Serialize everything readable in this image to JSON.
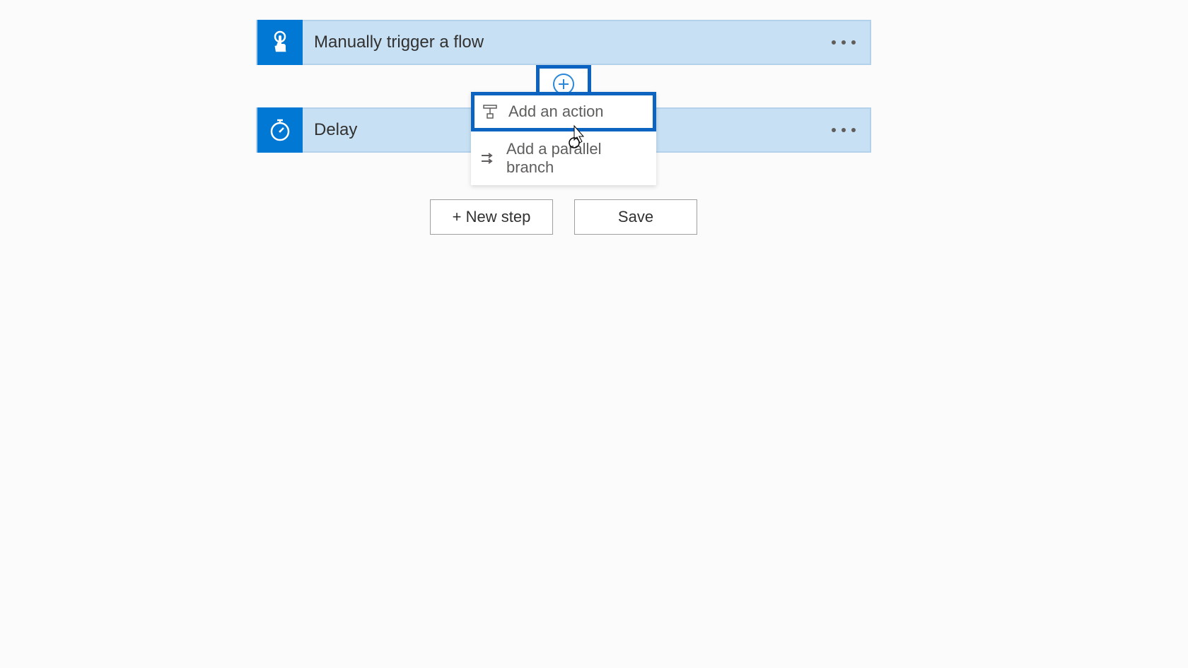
{
  "cards": {
    "trigger": {
      "title": "Manually trigger a flow"
    },
    "delay": {
      "title": "Delay"
    }
  },
  "insertMenu": {
    "addAction": "Add an action",
    "addParallelBranch": "Add a parallel branch"
  },
  "buttons": {
    "newStep": "+ New step",
    "save": "Save"
  }
}
